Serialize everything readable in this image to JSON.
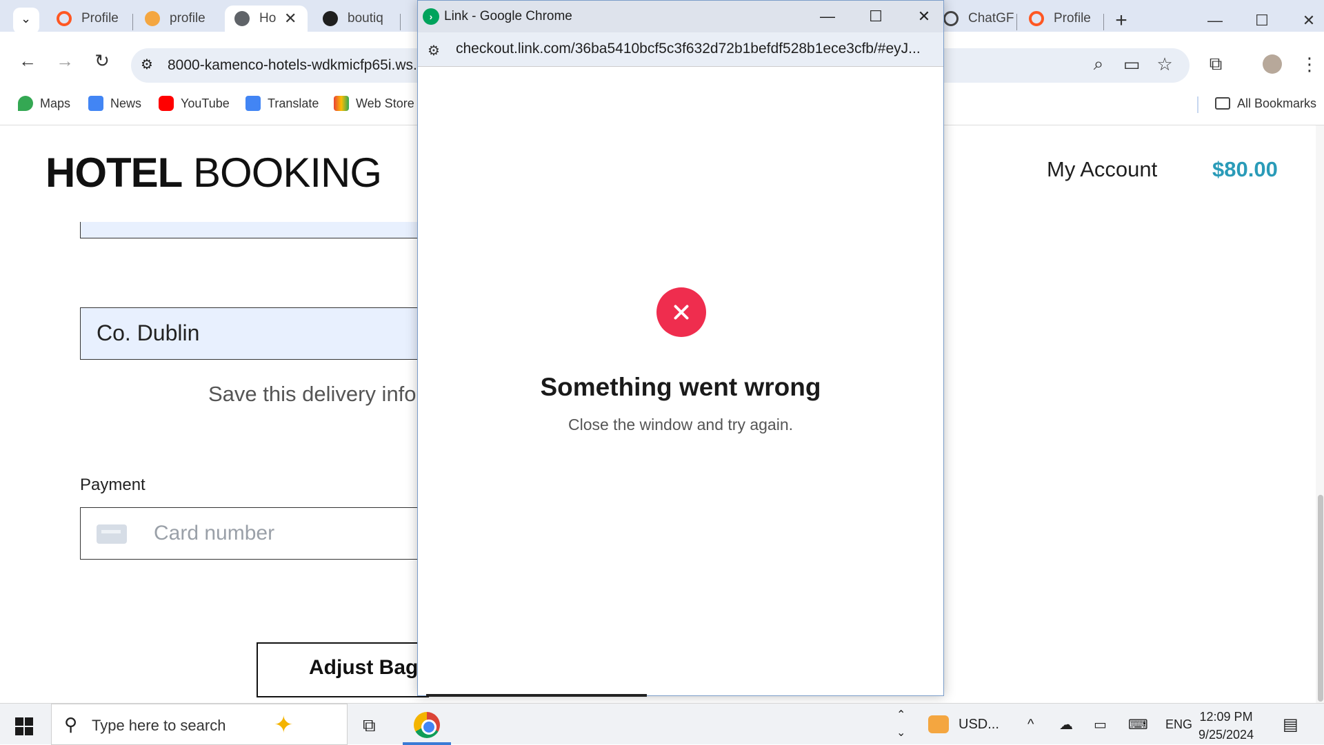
{
  "browser": {
    "tabs": [
      {
        "label": "Profile",
        "favicon_color": "#ff5722"
      },
      {
        "label": "profile",
        "favicon_color": "#f4a640"
      },
      {
        "label": "Ho",
        "favicon_color": "#5f6368",
        "active": true
      },
      {
        "label": "boutiq",
        "favicon_color": "#1f1f1f"
      },
      {
        "label": "ChatGF",
        "favicon_color": "#444444"
      },
      {
        "label": "Profile",
        "favicon_color": "#ff5722"
      }
    ],
    "new_tab_label": "+",
    "address_url": "8000-kamenco-hotels-wdkmicfp65i.ws.",
    "bookmarks": [
      {
        "label": "Maps",
        "icon": "maps-icon"
      },
      {
        "label": "News",
        "icon": "news-icon"
      },
      {
        "label": "YouTube",
        "icon": "youtube-icon"
      },
      {
        "label": "Translate",
        "icon": "translate-icon"
      },
      {
        "label": "Web Store",
        "icon": "webstore-icon"
      }
    ],
    "all_bookmarks_label": "All Bookmarks"
  },
  "page": {
    "logo_bold": "HOTEL",
    "logo_light": "BOOKING",
    "my_account": "My Account",
    "bag_total": "$80.00",
    "county_value": "Co. Dublin",
    "save_info": "Save this delivery infor",
    "payment_label": "Payment",
    "card_placeholder": "Card number",
    "adjust_bag": "Adjust Bag",
    "accent_color": "#2a9bb8"
  },
  "popup": {
    "window_title": "Link - Google Chrome",
    "url": "checkout.link.com/36ba5410bcf5c3f632d72b1befdf528b1ece3cfb/#eyJ...",
    "error_title": "Something went wrong",
    "error_message": "Close the window and try again.",
    "error_color": "#ef2d4e"
  },
  "taskbar": {
    "search_placeholder": "Type here to search",
    "currency_widget": "USD...",
    "language": "ENG",
    "time": "12:09 PM",
    "date": "9/25/2024"
  }
}
